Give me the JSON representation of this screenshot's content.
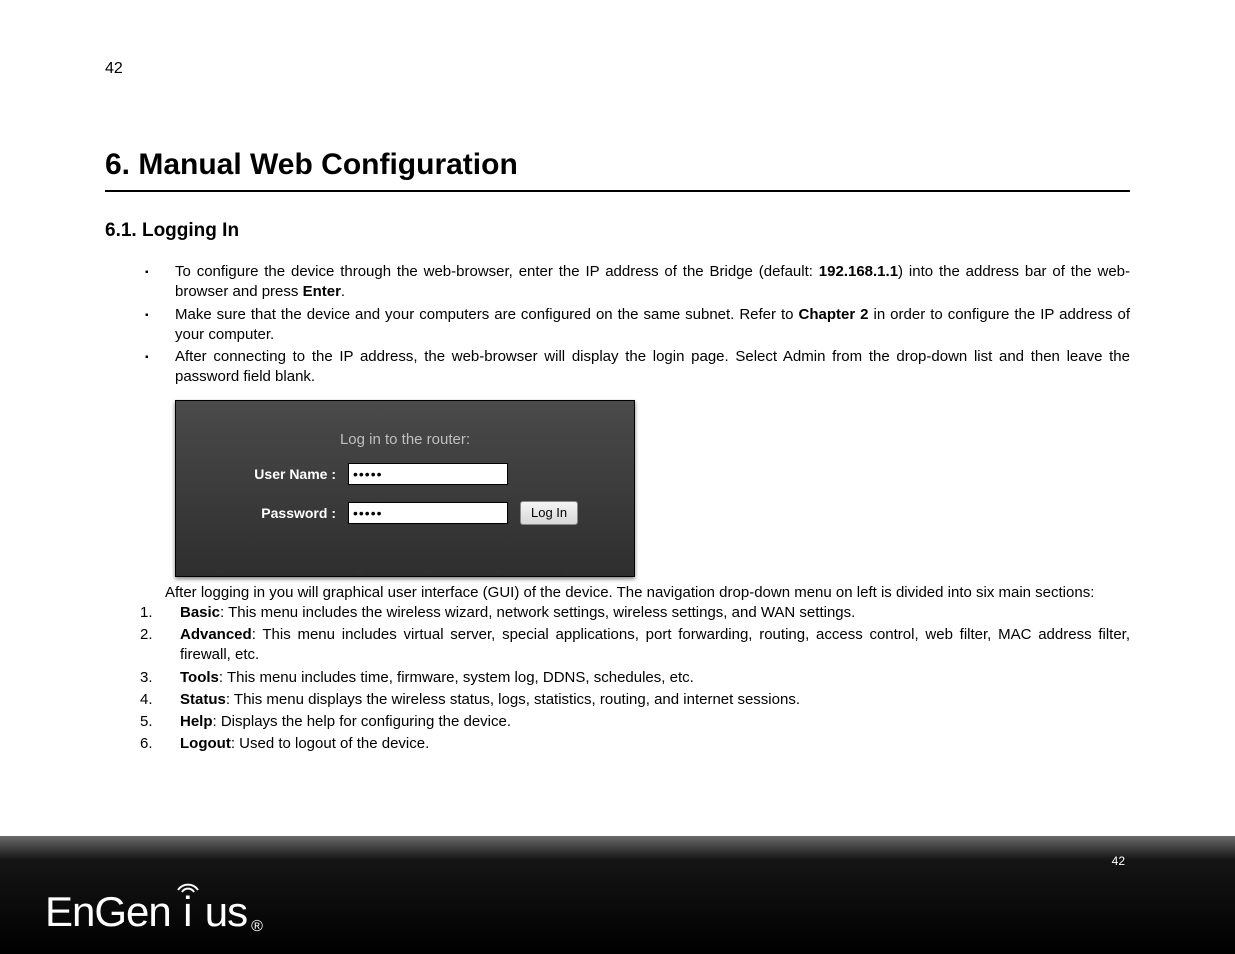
{
  "page": {
    "number_top": "42",
    "number_bottom": "42"
  },
  "headings": {
    "main": "6. Manual Web Configuration",
    "sub": "6.1.   Logging In"
  },
  "bullets": {
    "b1_pre": "To configure the device through the web-browser, enter the IP address of the Bridge (default: ",
    "b1_ip": "192.168.1.1",
    "b1_mid": ") into the address bar of the web-browser and press ",
    "b1_enter": "Enter",
    "b1_end": ".",
    "b2_pre": "Make sure that the device and your computers are configured on the same subnet. Refer to ",
    "b2_chap": "Chapter 2",
    "b2_end": " in order to configure the IP address of your computer.",
    "b3": "After connecting to the IP address, the web-browser will display the login page. Select Admin from the drop-down list and then leave the password field blank."
  },
  "login": {
    "title": "Log in to the router:",
    "username_label": "User Name :",
    "password_label": "Password :",
    "username_value": "•••••",
    "password_value": "•••••",
    "button": "Log In"
  },
  "after": {
    "line1": "After logging in you will graphical user interface (GUI) of the device. The navigation drop-down menu on left is divided into six main sections:"
  },
  "menus": {
    "m1_name": "Basic",
    "m1_desc": ": This menu includes the wireless wizard, network settings, wireless settings, and WAN settings.",
    "m2_name": "Advanced",
    "m2_desc": ": This menu includes virtual server, special applications, port forwarding, routing, access control, web filter, MAC address filter, firewall, etc.",
    "m3_name": "Tools",
    "m3_desc": ": This menu includes time, firmware, system log, DDNS, schedules, etc.",
    "m4_name": "Status",
    "m4_desc": ": This menu displays the wireless status, logs, statistics, routing, and internet sessions.",
    "m5_name": "Help",
    "m5_desc": ": Displays the help for configuring the device.",
    "m6_name": "Logout",
    "m6_desc": ":  Used to logout of the device."
  },
  "brand": {
    "part1": "EnGen",
    "part2": "us",
    "reg": "®"
  }
}
